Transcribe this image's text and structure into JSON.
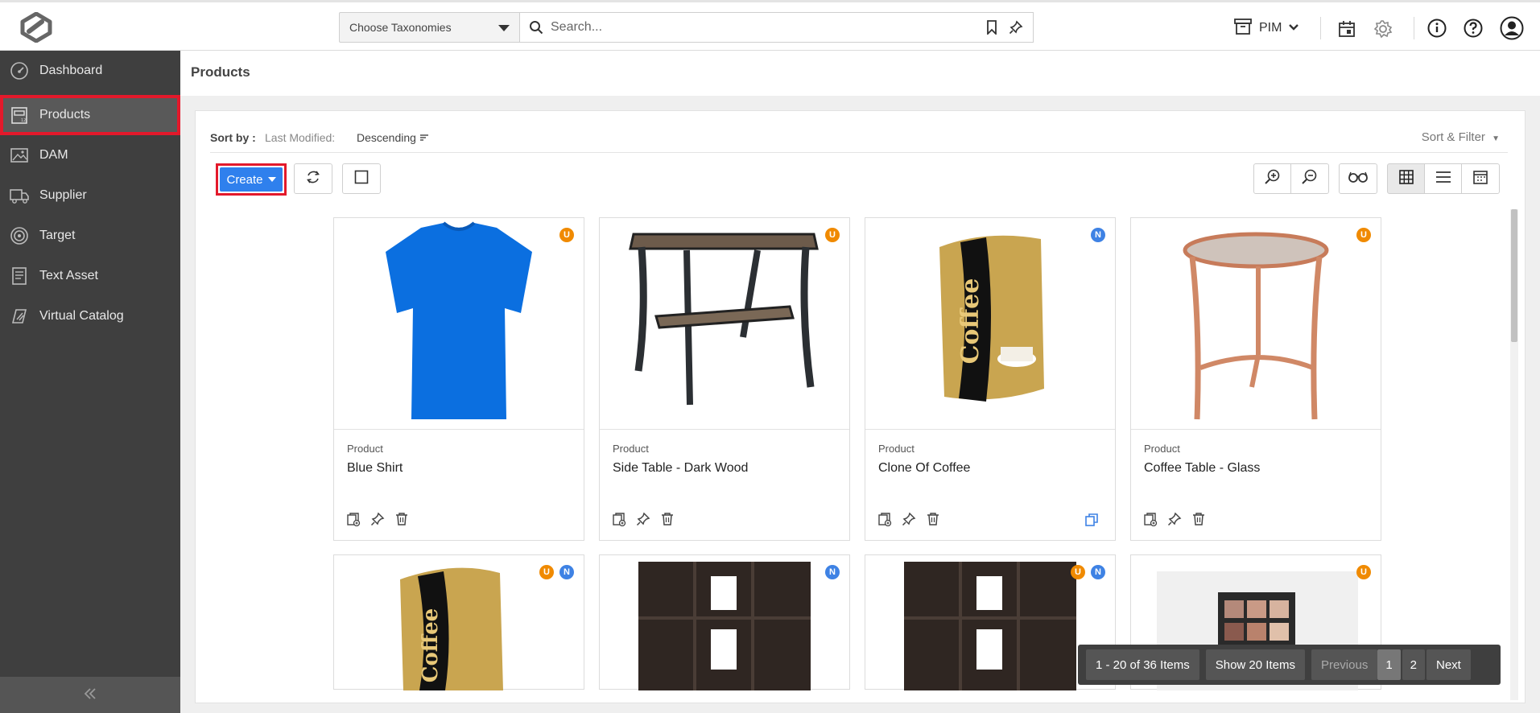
{
  "topbar": {
    "taxonomy_label": "Choose Taxonomies",
    "search_placeholder": "Search...",
    "app_switch": "PIM"
  },
  "sidebar": {
    "items": [
      {
        "label": "Dashboard",
        "icon": "gauge-icon"
      },
      {
        "label": "Products",
        "icon": "products-icon",
        "active": true
      },
      {
        "label": "DAM",
        "icon": "image-icon"
      },
      {
        "label": "Supplier",
        "icon": "truck-icon"
      },
      {
        "label": "Target",
        "icon": "target-icon"
      },
      {
        "label": "Text Asset",
        "icon": "document-icon"
      },
      {
        "label": "Virtual Catalog",
        "icon": "catalog-icon"
      }
    ]
  },
  "page": {
    "title": "Products"
  },
  "sort": {
    "label": "Sort by :",
    "field": "Last Modified:",
    "direction": "Descending",
    "sort_filter": "Sort & Filter"
  },
  "toolbar": {
    "create_label": "Create"
  },
  "products": [
    {
      "type": "Product",
      "name": "Blue Shirt",
      "badges": [
        "U"
      ]
    },
    {
      "type": "Product",
      "name": "Side Table - Dark Wood",
      "badges": [
        "U"
      ]
    },
    {
      "type": "Product",
      "name": "Clone Of Coffee",
      "badges": [
        "N"
      ]
    },
    {
      "type": "Product",
      "name": "Coffee Table - Glass",
      "badges": [
        "U"
      ]
    },
    {
      "type": "",
      "name": "",
      "badges": [
        "U",
        "N"
      ]
    },
    {
      "type": "",
      "name": "",
      "badges": [
        "N"
      ]
    },
    {
      "type": "",
      "name": "",
      "badges": [
        "U",
        "N"
      ]
    },
    {
      "type": "",
      "name": "",
      "badges": [
        "U"
      ]
    }
  ],
  "pagination": {
    "count": "1 - 20 of 36 Items",
    "show": "Show 20 Items",
    "previous": "Previous",
    "page1": "1",
    "page2": "2",
    "next": "Next"
  },
  "colors": {
    "accent": "#2f80ed",
    "highlight": "#e3192b",
    "sidebar": "#3f3f3f",
    "badge_u": "#f08a00",
    "badge_n": "#3e82e4"
  }
}
